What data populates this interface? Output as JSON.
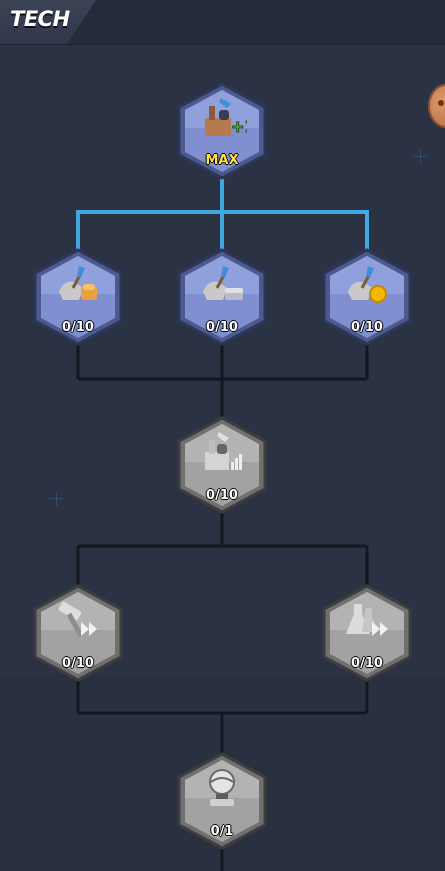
{
  "header": {
    "title": "TECH"
  },
  "colors": {
    "background": "#2b3243",
    "active_line": "#3fa9e0",
    "inactive_line": "#14171f",
    "hex_active": "#7f8fcf",
    "hex_locked": "#a9a9a9",
    "max_text": "#ffe24a"
  },
  "nodes": [
    {
      "id": "factory-plus-one",
      "icon": "factory-plus-icon",
      "label": "MAX",
      "state": "maxed"
    },
    {
      "id": "shovel-bread",
      "icon": "shovel-bread-icon",
      "label": "0/10",
      "state": "active"
    },
    {
      "id": "shovel-stone",
      "icon": "shovel-stone-icon",
      "label": "0/10",
      "state": "active"
    },
    {
      "id": "shovel-coin",
      "icon": "shovel-coin-icon",
      "label": "0/10",
      "state": "active"
    },
    {
      "id": "factory-chart",
      "icon": "factory-chart-icon",
      "label": "0/10",
      "state": "locked"
    },
    {
      "id": "hammer-speed",
      "icon": "hammer-speed-icon",
      "label": "0/10",
      "state": "locked"
    },
    {
      "id": "flask-speed",
      "icon": "flask-speed-icon",
      "label": "0/10",
      "state": "locked"
    },
    {
      "id": "globe-trophy",
      "icon": "globe-trophy-icon",
      "label": "0/1",
      "state": "locked"
    }
  ]
}
